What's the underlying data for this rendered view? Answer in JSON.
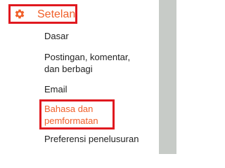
{
  "header": {
    "label": "Setelan",
    "icon": "gear-icon",
    "accent_color": "#f0602a",
    "highlight_color": "#e0191f"
  },
  "menu": {
    "items": [
      {
        "label": "Dasar"
      },
      {
        "line1": "Postingan, komentar,",
        "line2": "dan berbagi"
      },
      {
        "label": "Email"
      },
      {
        "line1": "Bahasa dan",
        "line2": "pemformatan",
        "active": true
      },
      {
        "label": "Preferensi penelusuran"
      }
    ]
  }
}
